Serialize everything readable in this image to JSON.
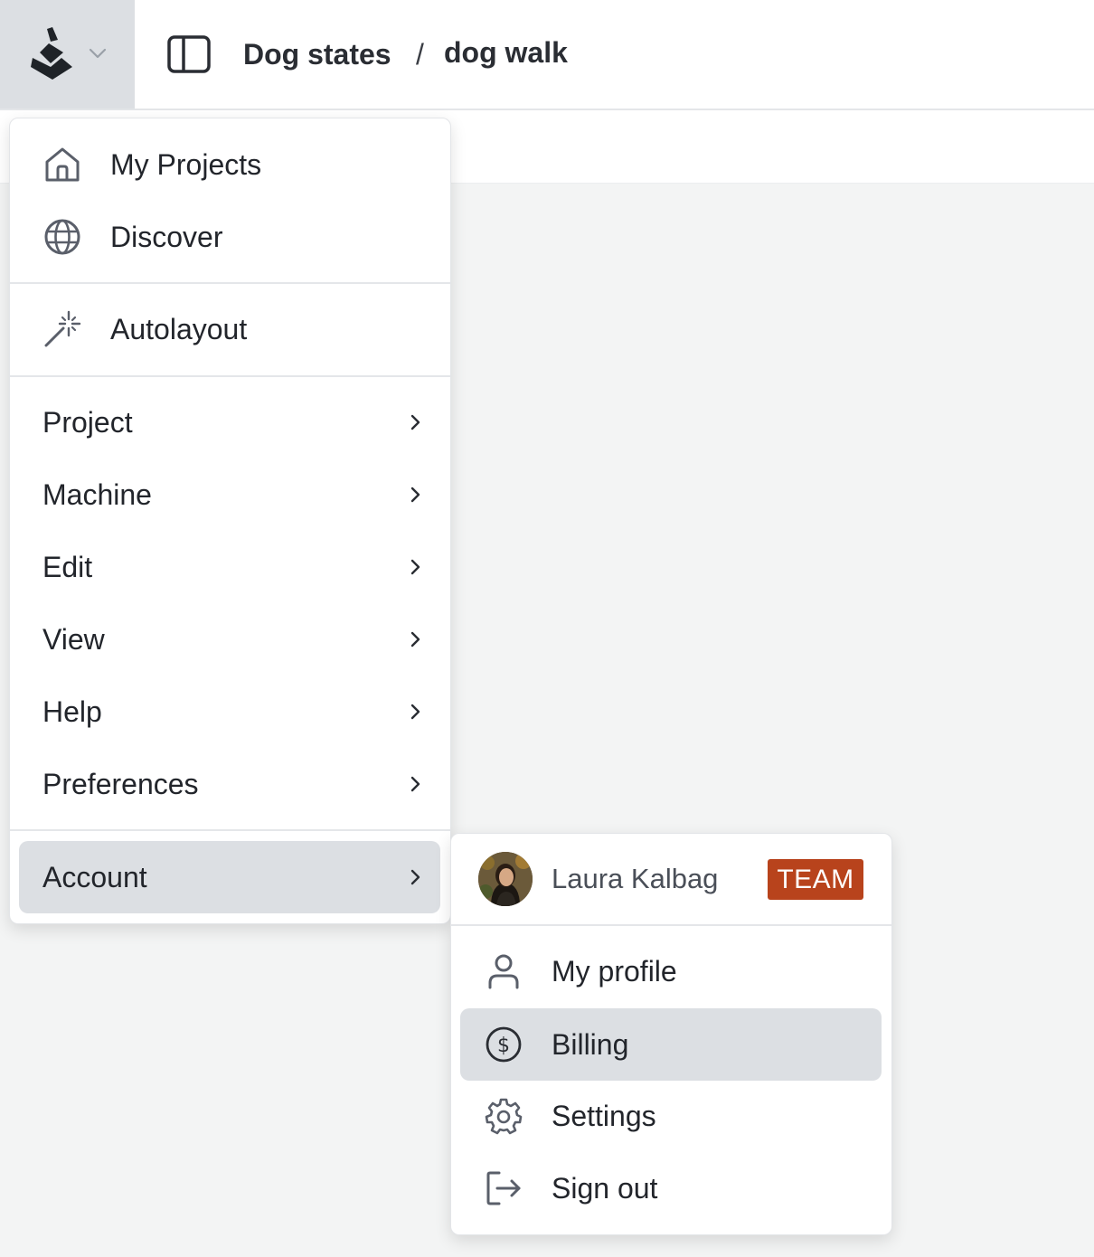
{
  "header": {
    "project_name": "Dog states",
    "separator": "/",
    "machine_name": "dog walk"
  },
  "main_menu": {
    "top_items": [
      {
        "label": "My Projects",
        "icon": "home-icon"
      },
      {
        "label": "Discover",
        "icon": "globe-icon"
      }
    ],
    "tool_items": [
      {
        "label": "Autolayout",
        "icon": "magic-wand-icon"
      }
    ],
    "submenu_items": [
      {
        "label": "Project"
      },
      {
        "label": "Machine"
      },
      {
        "label": "Edit"
      },
      {
        "label": "View"
      },
      {
        "label": "Help"
      },
      {
        "label": "Preferences"
      }
    ],
    "account_item": {
      "label": "Account",
      "active": true
    }
  },
  "account_menu": {
    "user_name": "Laura Kalbag",
    "plan_badge": "TEAM",
    "items": [
      {
        "label": "My profile",
        "icon": "user-icon"
      },
      {
        "label": "Billing",
        "icon": "dollar-circle-icon",
        "active": true
      },
      {
        "label": "Settings",
        "icon": "gear-icon"
      },
      {
        "label": "Sign out",
        "icon": "sign-out-icon"
      }
    ]
  },
  "colors": {
    "badge_bg": "#b8431c",
    "highlight_bg": "#dcdfe3",
    "canvas_bg": "#f3f4f4"
  }
}
